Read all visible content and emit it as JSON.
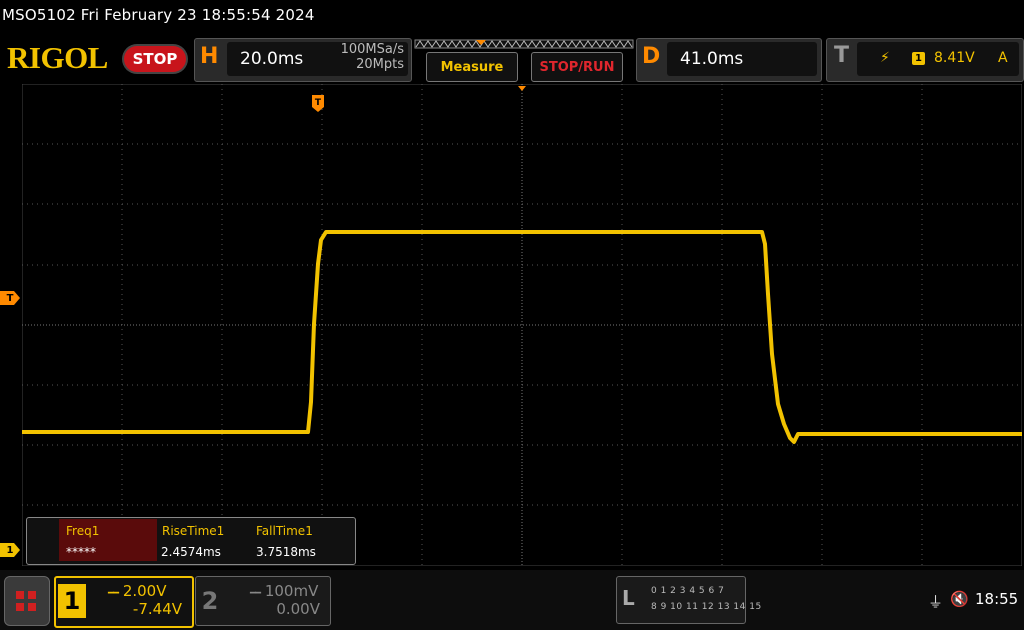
{
  "header": {
    "model_datetime": "MSO5102  Fri February 23 18:55:54 2024",
    "logo": "RIGOL",
    "run_state": "STOP"
  },
  "horizontal": {
    "letter": "H",
    "timebase": "20.0ms",
    "sample_rate": "100MSa/s",
    "memory_depth": "20Mpts"
  },
  "buttons": {
    "measure": "Measure",
    "stop_run": "STOP/RUN"
  },
  "delay": {
    "letter": "D",
    "value": "41.0ms"
  },
  "trigger": {
    "letter": "T",
    "edge_icon": "rising-edge-icon",
    "edge_glyph": "⚡",
    "source": "1",
    "level": "8.41V",
    "mode": "A",
    "marker": "T"
  },
  "waveform": {
    "channel_marker": "1",
    "color": "#f2c200"
  },
  "measurements": [
    {
      "label": "Freq1",
      "value": "*****"
    },
    {
      "label": "RiseTime1",
      "value": "2.4574ms"
    },
    {
      "label": "FallTime1",
      "value": "3.7518ms"
    }
  ],
  "channels": {
    "ch1": {
      "number": "1",
      "scale": "2.00V",
      "offset": "-7.44V",
      "coupling_glyph": "━━"
    },
    "ch2": {
      "number": "2",
      "scale": "100mV",
      "offset": "0.00V",
      "coupling_glyph": "━━"
    }
  },
  "logic_analyzer": {
    "letter": "L",
    "row1": "0 1 2 3   4 5 6 7",
    "row2": "8  9 10 11  12 13 14 15"
  },
  "status": {
    "usb_icon": "usb-icon",
    "usb_glyph": "⏚",
    "speaker_icon": "speaker-muted-icon",
    "speaker_glyph": "🔇",
    "time": "18:55"
  },
  "colors": {
    "accent": "#f2c200",
    "trigger": "#ff8a00",
    "stop": "#c8141b"
  }
}
